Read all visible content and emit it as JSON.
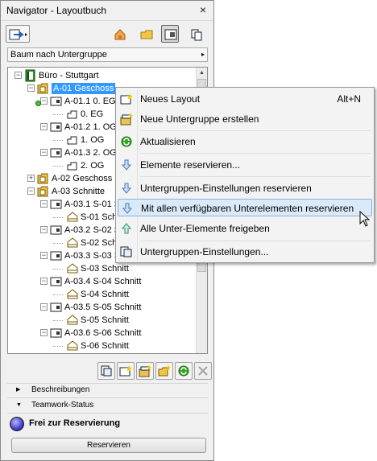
{
  "window": {
    "title": "Navigator - Layoutbuch",
    "close": "×"
  },
  "toolbar": {
    "buttons": [
      {
        "name": "export-icon"
      },
      {
        "name": "project-map-icon"
      },
      {
        "name": "view-map-icon"
      },
      {
        "name": "layout-book-icon",
        "selected": true
      },
      {
        "name": "publisher-icon"
      }
    ]
  },
  "dropdown": {
    "value": "Baum nach Untergruppe",
    "arrow": "▸"
  },
  "tree": {
    "items": [
      {
        "label": "Büro - Stuttgart",
        "level": 0,
        "icon": "book-icon",
        "expander": "−"
      },
      {
        "label": "A-01 Geschoss",
        "level": 1,
        "icon": "folder-icon",
        "expander": "−",
        "highlighted": true
      },
      {
        "label": "A-01.1 0. EG",
        "level": 2,
        "icon": "layout-icon",
        "expander": "−"
      },
      {
        "label": "0. EG",
        "level": 3,
        "icon": "view-icon"
      },
      {
        "label": "A-01.2 1. OG",
        "level": 2,
        "icon": "layout-icon",
        "expander": "−"
      },
      {
        "label": "1. OG",
        "level": 3,
        "icon": "view-icon"
      },
      {
        "label": "A-01.3 2. OG",
        "level": 2,
        "icon": "layout-icon",
        "expander": "−"
      },
      {
        "label": "2. OG",
        "level": 3,
        "icon": "view-icon"
      },
      {
        "label": "A-02 Geschoss",
        "level": 1,
        "icon": "folder-icon",
        "expander": "+"
      },
      {
        "label": "A-03 Schnitte",
        "level": 1,
        "icon": "folder-icon",
        "expander": "−"
      },
      {
        "label": "A-03.1 S-01 Schnitt",
        "level": 2,
        "icon": "layout-icon",
        "expander": "−"
      },
      {
        "label": "S-01 Schnitt",
        "level": 3,
        "icon": "section-view-icon"
      },
      {
        "label": "A-03.2 S-02 Schnitt",
        "level": 2,
        "icon": "layout-icon",
        "expander": "−"
      },
      {
        "label": "S-02 Schnitt",
        "level": 3,
        "icon": "section-view-icon"
      },
      {
        "label": "A-03.3 S-03 Schnitt",
        "level": 2,
        "icon": "layout-icon",
        "expander": "−"
      },
      {
        "label": "S-03 Schnitt",
        "level": 3,
        "icon": "section-view-icon"
      },
      {
        "label": "A-03.4 S-04 Schnitt",
        "level": 2,
        "icon": "layout-icon",
        "expander": "−"
      },
      {
        "label": "S-04 Schnitt",
        "level": 3,
        "icon": "section-view-icon"
      },
      {
        "label": "A-03.5 S-05 Schnitt",
        "level": 2,
        "icon": "layout-icon",
        "expander": "−"
      },
      {
        "label": "S-05 Schnitt",
        "level": 3,
        "icon": "section-view-icon"
      },
      {
        "label": "A-03.6 S-06 Schnitt",
        "level": 2,
        "icon": "layout-icon",
        "expander": "−"
      },
      {
        "label": "S-06 Schnitt",
        "level": 3,
        "icon": "section-view-icon"
      }
    ]
  },
  "bottom_buttons": [
    "settings-icon",
    "new-layout-icon",
    "new-subset-icon",
    "new-folder-icon",
    "refresh-icon",
    "delete-icon"
  ],
  "sections": {
    "descriptions": "Beschreibungen",
    "teamwork": "Teamwork-Status"
  },
  "status": {
    "text": "Frei zur Reservierung"
  },
  "reserve_button": "Reservieren",
  "context_menu": {
    "items": [
      {
        "label": "Neues Layout",
        "shortcut": "Alt+N",
        "icon": "new-layout-icon"
      },
      {
        "label": "Neue Untergruppe erstellen",
        "shortcut": "",
        "icon": "new-subset-icon"
      },
      {
        "label": "Aktualisieren",
        "shortcut": "",
        "icon": "refresh-icon"
      },
      {
        "label": "Elemente reservieren...",
        "shortcut": "",
        "icon": "reserve-icon"
      },
      {
        "label": "Untergruppen-Einstellungen reservieren",
        "shortcut": "",
        "icon": "reserve-icon"
      },
      {
        "label": "Mit allen verfügbaren Unterelementen reservieren",
        "shortcut": "",
        "icon": "reserve-icon",
        "hover": true
      },
      {
        "label": "Alle Unter-Elemente freigeben",
        "shortcut": "",
        "icon": "release-icon"
      },
      {
        "label": "Untergruppen-Einstellungen...",
        "shortcut": "",
        "icon": "settings-icon"
      }
    ]
  },
  "colors": {
    "highlight": "#3399ff",
    "menu_hover": "#dbeaf8",
    "status_ball": "#3838c8"
  }
}
